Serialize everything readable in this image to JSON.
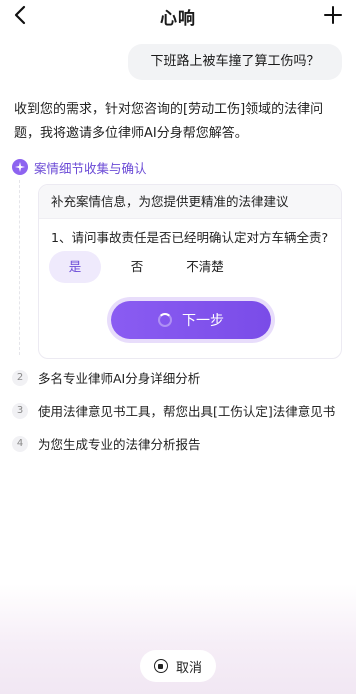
{
  "header": {
    "title": "心响"
  },
  "chat": {
    "user_message": "下班路上被车撞了算工伤吗？",
    "reply": "收到您的需求，针对您咨询的[劳动工伤]领域的法律问题，我将邀请多位律师AI分身帮您解答。"
  },
  "steps": [
    {
      "num": "1",
      "label": "案情细节收集与确认"
    },
    {
      "num": "2",
      "label": "多名专业律师AI分身详细分析"
    },
    {
      "num": "3",
      "label": "使用法律意见书工具，帮您出具[工伤认定]法律意见书"
    },
    {
      "num": "4",
      "label": "为您生成专业的法律分析报告"
    }
  ],
  "card": {
    "header": "补充案情信息，为您提供更精准的法律建议",
    "question": "1、请问事故责任是否已经明确认定对方车辆全责?",
    "options": [
      "是",
      "否",
      "不清楚"
    ],
    "selected_option": "是",
    "next_label": "下一步"
  },
  "cancel_label": "取消",
  "colors": {
    "accent": "#7a4ce8",
    "accent_light": "#efeafc"
  }
}
